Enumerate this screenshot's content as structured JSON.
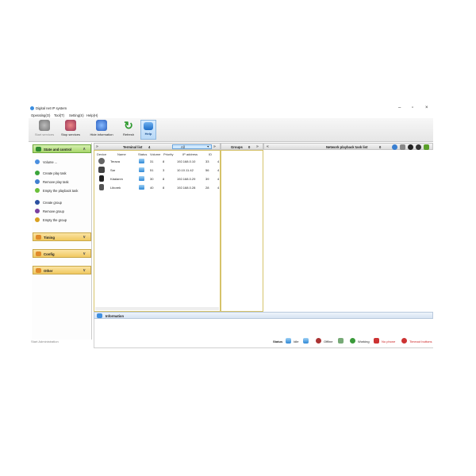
{
  "window": {
    "title": "Digital net IP system",
    "menu": [
      "Operating(O)",
      "Tool(T)",
      "Setting(S)",
      "Help(H)"
    ]
  },
  "toolbar": {
    "start_services": "Start services",
    "stop_services": "Stop services",
    "hide_information": "Hide information",
    "refresh": "Refresh",
    "help": "Help"
  },
  "sidebar": {
    "state_control": "State and control",
    "items": [
      "Volume ...",
      "Create play task",
      "Remove play task",
      "Empty the playback task",
      "Create group",
      "Remove group",
      "Empty the group"
    ],
    "timing": "Timing",
    "config": "Config",
    "other": "Other"
  },
  "terminal_list": {
    "title": "Terminal list",
    "count": "4",
    "filter": "All",
    "columns": [
      "Device",
      "Name",
      "Status",
      "Volume",
      "Priority",
      "IP address",
      "ID"
    ],
    "rows": [
      {
        "name": "Terava",
        "volume": "31",
        "priority": "8",
        "ip": "192.168.0.10",
        "id": "33",
        "extra": "4"
      },
      {
        "name": "Sar",
        "volume": "51",
        "priority": "3",
        "ip": "10.10.11.42",
        "id": "56",
        "extra": "4"
      },
      {
        "name": "Käalanm",
        "volume": "30",
        "priority": "8",
        "ip": "192.168.0.29",
        "id": "39",
        "extra": "4"
      },
      {
        "name": "Liborek",
        "volume": "40",
        "priority": "8",
        "ip": "192.168.0.28",
        "id": "28",
        "extra": "4"
      }
    ]
  },
  "groups": {
    "title": "Groups",
    "count": "0"
  },
  "playback": {
    "title": "Network playback task list",
    "count": "0"
  },
  "information": {
    "title": "Information"
  },
  "statusbar": {
    "left": "Start Administration",
    "status": "Status",
    "idle": "Idle",
    "offline": "Offline",
    "working": "Working",
    "no_phone": "No phone",
    "timeout": "Timeout buttons"
  },
  "colors": {
    "accent": "#3f8fe0",
    "section": "#f0c860",
    "section_active": "#a7d56b",
    "panel_border": "#d6c36a"
  }
}
